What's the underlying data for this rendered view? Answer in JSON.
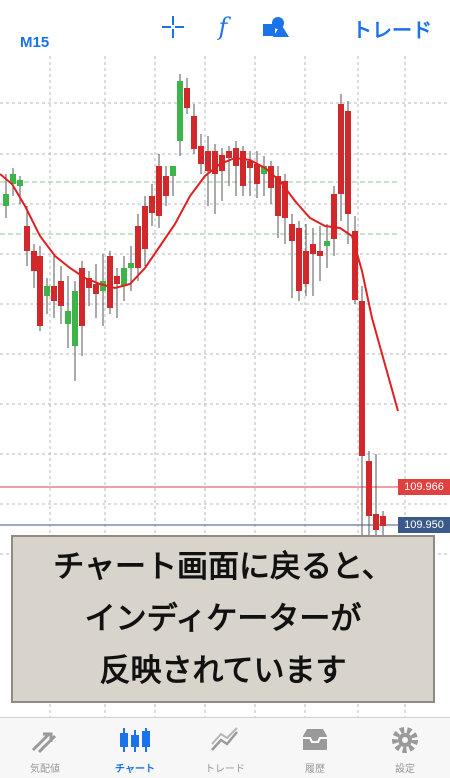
{
  "toolbar": {
    "icons": [
      "crosshair-icon",
      "function-icon",
      "objects-icon"
    ],
    "function_glyph": "f",
    "trade_label": "トレード"
  },
  "timeframe": "M15",
  "price_tags": [
    "109.966",
    "109.950"
  ],
  "colors": {
    "accent": "#1a73e8",
    "bull": "#3bb54a",
    "bear": "#d0282b",
    "indicator": "#e02020"
  },
  "caption": {
    "line1": "チャート画面に戻ると、",
    "line2": "インディケーターが",
    "line3": "反映されています"
  },
  "nav": {
    "items": [
      {
        "label": "気配値",
        "icon": "quotes-icon"
      },
      {
        "label": "チャート",
        "icon": "candlestick-icon"
      },
      {
        "label": "トレード",
        "icon": "trade-icon"
      },
      {
        "label": "履歴",
        "icon": "history-icon"
      },
      {
        "label": "設定",
        "icon": "settings-gear-icon"
      }
    ],
    "active_index": 1
  }
}
